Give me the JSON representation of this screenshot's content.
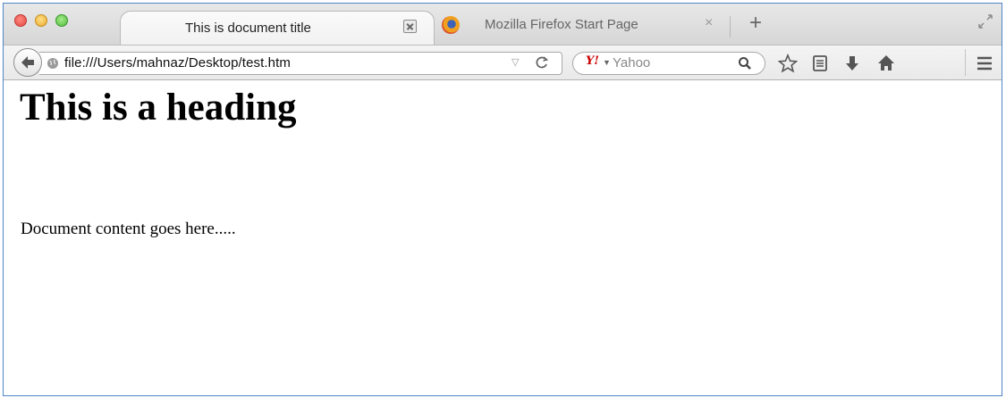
{
  "browser": {
    "tabs": [
      {
        "title": "This is document title",
        "active": true
      },
      {
        "title": "Mozilla Firefox Start Page",
        "active": false
      }
    ],
    "new_tab_label": "+",
    "close_label": "×"
  },
  "navbar": {
    "url": "file:///Users/mahnaz/Desktop/test.htm",
    "search_engine": "Y!",
    "search_placeholder": "Yahoo"
  },
  "page": {
    "heading": "This is a heading",
    "paragraph": "Document content goes here....."
  },
  "icons": [
    "back-arrow-icon",
    "globe-icon",
    "reload-icon",
    "search-icon",
    "bookmark-star-icon",
    "reading-list-icon",
    "download-icon",
    "home-icon",
    "menu-icon",
    "fullscreen-icon",
    "firefox-logo-icon"
  ]
}
